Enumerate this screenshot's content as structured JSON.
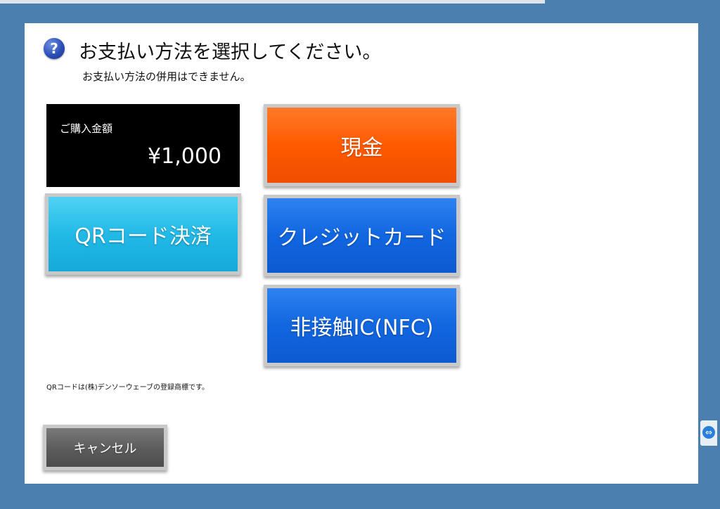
{
  "header": {
    "title": "お支払い方法を選択してください。",
    "subtitle": "お支払い方法の併用はできません。",
    "help_icon_glyph": "?"
  },
  "purchase": {
    "label": "ご購入金額",
    "amount": "¥1,000"
  },
  "buttons": {
    "cash": "現金",
    "qr": "QRコード決済",
    "credit": "クレジットカード",
    "nfc": "非接触IC(NFC)",
    "cancel": "キャンセル"
  },
  "footer": {
    "trademark": "QRコードは(株)デンソーウェーブの登録商標です。"
  },
  "side_tab": {
    "icon": "remote-control-icon",
    "glyph": "⇔"
  },
  "colors": {
    "background": "#4a7fb0",
    "cash": "#ff5a00",
    "qr": "#22b9e7",
    "card": "#1166e0",
    "cancel": "#5e5e5e",
    "amount_bg": "#000000"
  }
}
